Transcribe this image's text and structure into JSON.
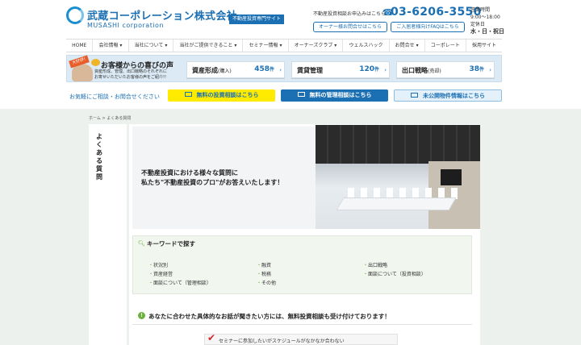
{
  "header": {
    "logo_jp": "武蔵コーポレーション株式会社",
    "logo_en": "MUSASHI corporation",
    "tag": "不動産投資専門サイト",
    "contact_label": "不動産投資相談お申込みはこちら",
    "phone": "03-6206-3550",
    "hours_label": "営業時間",
    "hours": "9:00〜18:00",
    "holiday_label": "定休日",
    "holiday": "水・日・祝日",
    "owner_button": "オーナー様お問合せはこちら",
    "buyer_button": "ご入居者様向けFAQはこちら"
  },
  "nav": [
    "HOME",
    "会社情報 ▾",
    "当社について ▾",
    "当社がご提供できること ▾",
    "セミナー情報 ▾",
    "オーナーズクラブ ▾",
    "ウェルスハック",
    "お問合せ ▾",
    "コーポレート",
    "採用サイト"
  ],
  "voice": {
    "badge": "大好評!",
    "title": "お客様からの喜びの声",
    "desc1": "資産形成、管理、出口戦略のそれぞれに",
    "desc2": "お寄せいただいたお客様の声をご紹介!!",
    "items": [
      {
        "label": "資産形成",
        "sub": "(購入)",
        "count": "458",
        "unit": "件"
      },
      {
        "label": "賃貸管理",
        "sub": "",
        "count": "120",
        "unit": "件"
      },
      {
        "label": "出口戦略",
        "sub": "(売却)",
        "count": "38",
        "unit": "件"
      }
    ]
  },
  "cta": {
    "label": "お気軽にご相談・お問合せください",
    "invest": "無料の投資相談はこちら",
    "manage": "無料の管理相談はこちら",
    "property": "未公開物件情報はこちら"
  },
  "breadcrumb": "ホーム > よくある質問",
  "side_title": "よくある質問",
  "hero": {
    "line1": "不動産投資における様々な質問に",
    "line2": "私たち\"不動産投資のプロ\"がお答えいたします！"
  },
  "keyword": {
    "title": "キーワードで探す",
    "col1": [
      "状況別",
      "資産経営",
      "面談について（管理相談）"
    ],
    "col2": [
      "融資",
      "税務",
      "その他"
    ],
    "col3": [
      "出口戦略",
      "面談について（投資相談）"
    ]
  },
  "notice": "あなたに合わせた具体的なお話が聞きたい方には、無料投資相談も受け付けております！",
  "checklist": [
    "セミナーに参加したいがスケジュールがなかなか合わない"
  ]
}
